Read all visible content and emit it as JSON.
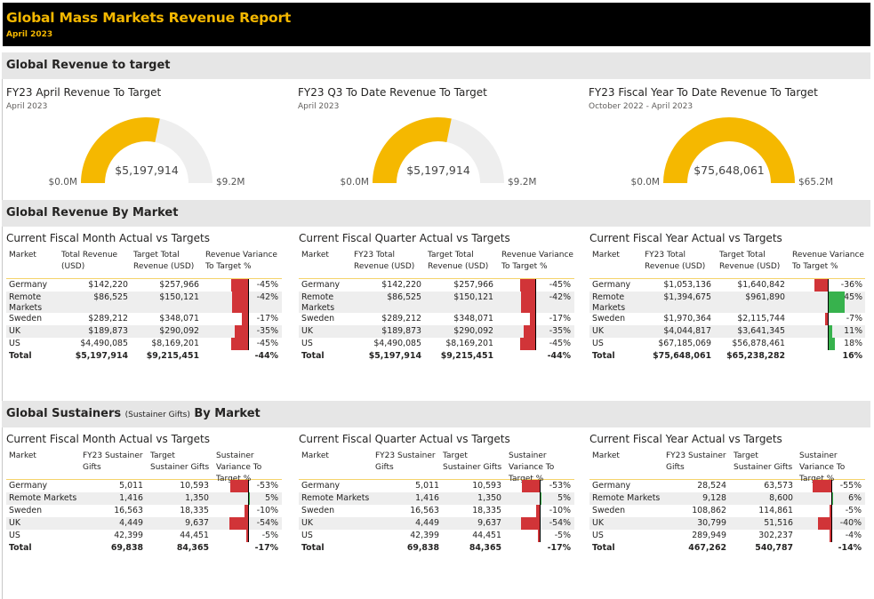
{
  "header": {
    "title": "Global Mass Markets Revenue Report",
    "subtitle": "April 2023"
  },
  "sections": {
    "revenue_to_target": "Global Revenue to target",
    "revenue_by_market": "Global Revenue By Market",
    "sustainers_prefix": "Global Sustainers",
    "sustainers_small": "(Sustainer Gifts)",
    "sustainers_suffix": "By Market"
  },
  "gauges": [
    {
      "title": "FY23 April Revenue To Target",
      "subtitle": "April 2023",
      "value": "$5,197,914",
      "min": "$0.0M",
      "max": "$9.2M",
      "fraction": 0.564
    },
    {
      "title": "FY23 Q3 To Date Revenue To Target",
      "subtitle": "April 2023",
      "value": "$5,197,914",
      "min": "$0.0M",
      "max": "$9.2M",
      "fraction": 0.564
    },
    {
      "title": "FY23 Fiscal Year To Date Revenue To Target",
      "subtitle": "October 2022 - April 2023",
      "value": "$75,648,061",
      "min": "$0.0M",
      "max": "$65.2M",
      "fraction": 1.0
    }
  ],
  "revenue_tables": [
    {
      "title": "Current Fiscal Month Actual vs Targets",
      "headers": [
        "Market",
        "Total Revenue (USD)",
        "Target Total Revenue (USD)",
        "Revenue Variance To Target %"
      ],
      "rows": [
        {
          "market": "Germany",
          "actual": "$142,220",
          "target": "$257,966",
          "pct": "-45%",
          "v": -45
        },
        {
          "market": "Remote Markets",
          "actual": "$86,525",
          "target": "$150,121",
          "pct": "-42%",
          "v": -42
        },
        {
          "market": "Sweden",
          "actual": "$289,212",
          "target": "$348,071",
          "pct": "-17%",
          "v": -17
        },
        {
          "market": "UK",
          "actual": "$189,873",
          "target": "$290,092",
          "pct": "-35%",
          "v": -35
        },
        {
          "market": "US",
          "actual": "$4,490,085",
          "target": "$8,169,201",
          "pct": "-45%",
          "v": -45
        }
      ],
      "total": {
        "market": "Total",
        "actual": "$5,197,914",
        "target": "$9,215,451",
        "pct": "-44%"
      }
    },
    {
      "title": "Current Fiscal Quarter Actual vs Targets",
      "headers": [
        "Market",
        "FY23 Total Revenue (USD)",
        "Target Total Revenue (USD)",
        "Revenue Variance To Target %"
      ],
      "rows": [
        {
          "market": "Germany",
          "actual": "$142,220",
          "target": "$257,966",
          "pct": "-45%",
          "v": -45
        },
        {
          "market": "Remote Markets",
          "actual": "$86,525",
          "target": "$150,121",
          "pct": "-42%",
          "v": -42
        },
        {
          "market": "Sweden",
          "actual": "$289,212",
          "target": "$348,071",
          "pct": "-17%",
          "v": -17
        },
        {
          "market": "UK",
          "actual": "$189,873",
          "target": "$290,092",
          "pct": "-35%",
          "v": -35
        },
        {
          "market": "US",
          "actual": "$4,490,085",
          "target": "$8,169,201",
          "pct": "-45%",
          "v": -45
        }
      ],
      "total": {
        "market": "Total",
        "actual": "$5,197,914",
        "target": "$9,215,451",
        "pct": "-44%"
      }
    },
    {
      "title": "Current Fiscal Year Actual vs Targets",
      "headers": [
        "Market",
        "FY23 Total Revenue (USD)",
        "Target Total Revenue (USD)",
        "Revenue Variance To Target %"
      ],
      "rows": [
        {
          "market": "Germany",
          "actual": "$1,053,136",
          "target": "$1,640,842",
          "pct": "-36%",
          "v": -36
        },
        {
          "market": "Remote Markets",
          "actual": "$1,394,675",
          "target": "$961,890",
          "pct": "45%",
          "v": 45
        },
        {
          "market": "Sweden",
          "actual": "$1,970,364",
          "target": "$2,115,744",
          "pct": "-7%",
          "v": -7
        },
        {
          "market": "UK",
          "actual": "$4,044,817",
          "target": "$3,641,345",
          "pct": "11%",
          "v": 11
        },
        {
          "market": "US",
          "actual": "$67,185,069",
          "target": "$56,878,461",
          "pct": "18%",
          "v": 18
        }
      ],
      "total": {
        "market": "Total",
        "actual": "$75,648,061",
        "target": "$65,238,282",
        "pct": "16%"
      }
    }
  ],
  "sustainer_tables": [
    {
      "title": "Current Fiscal Month Actual vs Targets",
      "headers": [
        "Market",
        "FY23 Sustainer Gifts",
        "Target Sustainer Gifts",
        "Sustainer Variance To Target %"
      ],
      "rows": [
        {
          "market": "Germany",
          "actual": "5,011",
          "target": "10,593",
          "pct": "-53%",
          "v": -53
        },
        {
          "market": "Remote Markets",
          "actual": "1,416",
          "target": "1,350",
          "pct": "5%",
          "v": 5
        },
        {
          "market": "Sweden",
          "actual": "16,563",
          "target": "18,335",
          "pct": "-10%",
          "v": -10
        },
        {
          "market": "UK",
          "actual": "4,449",
          "target": "9,637",
          "pct": "-54%",
          "v": -54
        },
        {
          "market": "US",
          "actual": "42,399",
          "target": "44,451",
          "pct": "-5%",
          "v": -5
        }
      ],
      "total": {
        "market": "Total",
        "actual": "69,838",
        "target": "84,365",
        "pct": "-17%"
      }
    },
    {
      "title": "Current Fiscal Quarter Actual vs Targets",
      "headers": [
        "Market",
        "FY23 Sustainer Gifts",
        "Target Sustainer Gifts",
        "Sustainer Variance To Target %"
      ],
      "rows": [
        {
          "market": "Germany",
          "actual": "5,011",
          "target": "10,593",
          "pct": "-53%",
          "v": -53
        },
        {
          "market": "Remote Markets",
          "actual": "1,416",
          "target": "1,350",
          "pct": "5%",
          "v": 5
        },
        {
          "market": "Sweden",
          "actual": "16,563",
          "target": "18,335",
          "pct": "-10%",
          "v": -10
        },
        {
          "market": "UK",
          "actual": "4,449",
          "target": "9,637",
          "pct": "-54%",
          "v": -54
        },
        {
          "market": "US",
          "actual": "42,399",
          "target": "44,451",
          "pct": "-5%",
          "v": -5
        }
      ],
      "total": {
        "market": "Total",
        "actual": "69,838",
        "target": "84,365",
        "pct": "-17%"
      }
    },
    {
      "title": "Current Fiscal Year Actual vs Targets",
      "headers": [
        "Market",
        "FY23 Sustainer Gifts",
        "Target Sustainer Gifts",
        "Sustainer Variance To Target %"
      ],
      "rows": [
        {
          "market": "Germany",
          "actual": "28,524",
          "target": "63,573",
          "pct": "-55%",
          "v": -55
        },
        {
          "market": "Remote Markets",
          "actual": "9,128",
          "target": "8,600",
          "pct": "6%",
          "v": 6
        },
        {
          "market": "Sweden",
          "actual": "108,862",
          "target": "114,861",
          "pct": "-5%",
          "v": -5
        },
        {
          "market": "UK",
          "actual": "30,799",
          "target": "51,516",
          "pct": "-40%",
          "v": -40
        },
        {
          "market": "US",
          "actual": "289,949",
          "target": "302,237",
          "pct": "-4%",
          "v": -4
        }
      ],
      "total": {
        "market": "Total",
        "actual": "467,262",
        "target": "540,787",
        "pct": "-14%"
      }
    }
  ],
  "colors": {
    "accent": "#F5B800",
    "gauge_track": "#eeeeee",
    "negative": "#d13438",
    "positive": "#37b24d"
  }
}
